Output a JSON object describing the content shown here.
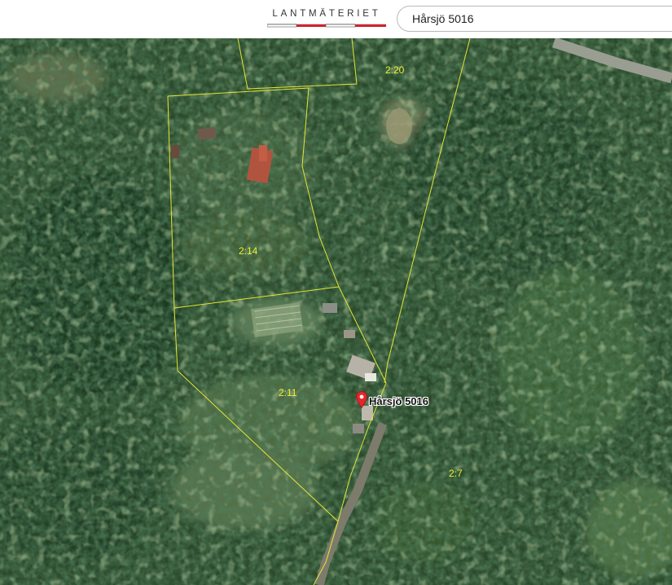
{
  "header": {
    "logo_text": "LANTMÄTERIET",
    "search_value": "Hårsjö 5016"
  },
  "map": {
    "marker_label": "Hårsjö 5016",
    "parcels": [
      "2:20",
      "2:14",
      "2:11",
      "2:7"
    ]
  },
  "colors": {
    "boundary": "#e6e630",
    "label": "#f2f232",
    "marker": "#e8252b",
    "logo_red": "#d5212e"
  }
}
